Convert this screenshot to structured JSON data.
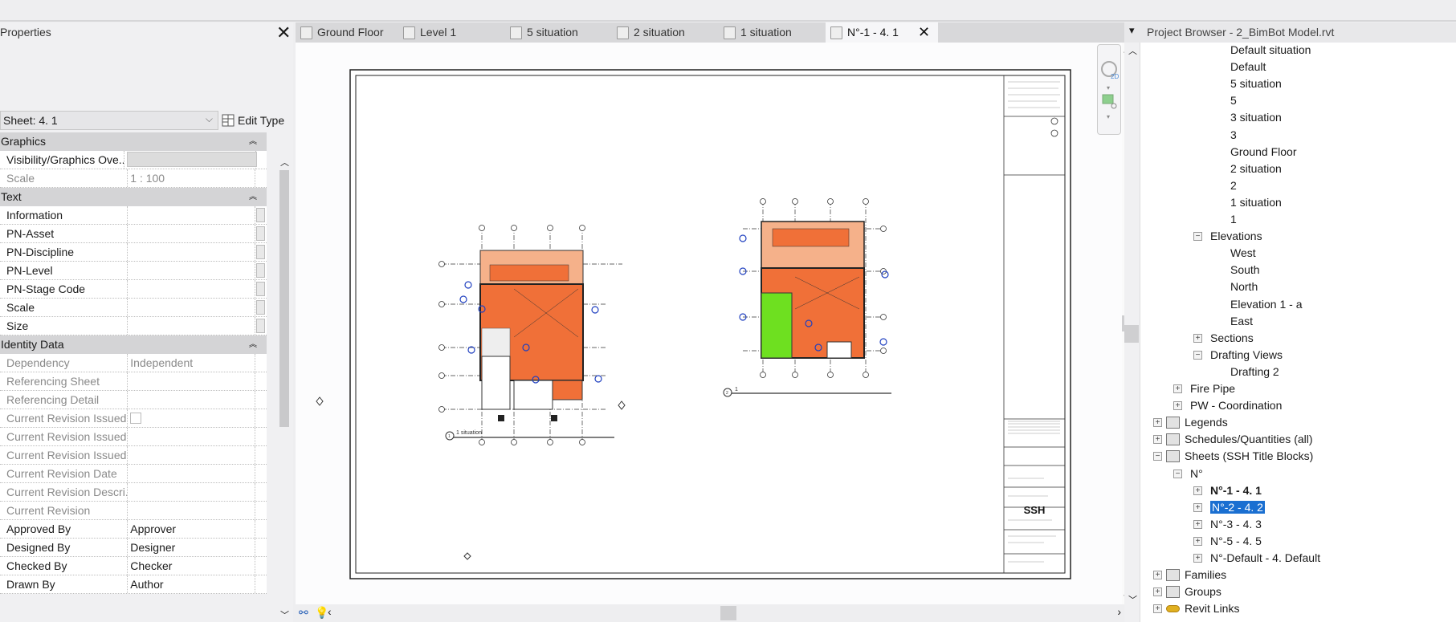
{
  "properties": {
    "title": "Properties",
    "type_selector": "Sheet: 4. 1",
    "edit_type_label": "Edit Type",
    "sections": [
      {
        "name": "Graphics",
        "rows": [
          {
            "key": "Visibility/Graphics Ove...",
            "value": "",
            "readonly": false,
            "kind": "button"
          },
          {
            "key": "Scale",
            "value": "1 : 100",
            "readonly": true
          }
        ]
      },
      {
        "name": "Text",
        "rows": [
          {
            "key": "Information",
            "value": ""
          },
          {
            "key": "PN-Asset",
            "value": ""
          },
          {
            "key": "PN-Discipline",
            "value": ""
          },
          {
            "key": "PN-Level",
            "value": ""
          },
          {
            "key": "PN-Stage Code",
            "value": ""
          },
          {
            "key": "Scale",
            "value": ""
          },
          {
            "key": "Size",
            "value": ""
          }
        ]
      },
      {
        "name": "Identity Data",
        "rows": [
          {
            "key": "Dependency",
            "value": "Independent",
            "readonly": true
          },
          {
            "key": "Referencing Sheet",
            "value": "",
            "readonly": true
          },
          {
            "key": "Referencing Detail",
            "value": "",
            "readonly": true
          },
          {
            "key": "Current Revision Issued",
            "value": "",
            "readonly": true,
            "kind": "checkbox",
            "checked": false
          },
          {
            "key": "Current Revision Issued...",
            "value": "",
            "readonly": true
          },
          {
            "key": "Current Revision Issued...",
            "value": "",
            "readonly": true
          },
          {
            "key": "Current Revision Date",
            "value": "",
            "readonly": true
          },
          {
            "key": "Current Revision Descri...",
            "value": "",
            "readonly": true
          },
          {
            "key": "Current Revision",
            "value": "",
            "readonly": true
          },
          {
            "key": "Approved By",
            "value": "Approver"
          },
          {
            "key": "Designed By",
            "value": "Designer"
          },
          {
            "key": "Checked By",
            "value": "Checker"
          },
          {
            "key": "Drawn By",
            "value": "Author"
          }
        ]
      }
    ]
  },
  "tabs": [
    {
      "label": "Ground Floor",
      "active": false
    },
    {
      "label": "Level 1",
      "active": false
    },
    {
      "label": "5 situation",
      "active": false
    },
    {
      "label": "2 situation",
      "active": false
    },
    {
      "label": "1 situation",
      "active": false
    },
    {
      "label": "N°-1 - 4. 1",
      "active": true
    }
  ],
  "sheet": {
    "view1_title": "1 situation",
    "view1_number": "1",
    "view2_title": "1",
    "view2_number": "2",
    "title_block_logo": "SSH",
    "plan_color": "#f07038",
    "wet_area_color": "#6ee020",
    "tag_color": "#2040c0"
  },
  "browser": {
    "title": "Project Browser - 2_BimBot Model.rvt",
    "items": [
      {
        "label": "Default situation",
        "depth": 3
      },
      {
        "label": "Default",
        "depth": 3
      },
      {
        "label": "5 situation",
        "depth": 3
      },
      {
        "label": "5",
        "depth": 3
      },
      {
        "label": "3 situation",
        "depth": 3
      },
      {
        "label": "3",
        "depth": 3
      },
      {
        "label": "Ground Floor",
        "depth": 3
      },
      {
        "label": "2 situation",
        "depth": 3
      },
      {
        "label": "2",
        "depth": 3
      },
      {
        "label": "1 situation",
        "depth": 3
      },
      {
        "label": "1",
        "depth": 3
      },
      {
        "label": "Elevations",
        "depth": 2,
        "state": "expanded"
      },
      {
        "label": "West",
        "depth": 3
      },
      {
        "label": "South",
        "depth": 3
      },
      {
        "label": "North",
        "depth": 3
      },
      {
        "label": "Elevation 1 - a",
        "depth": 3
      },
      {
        "label": "East",
        "depth": 3
      },
      {
        "label": "Sections",
        "depth": 2,
        "state": "collapsed"
      },
      {
        "label": "Drafting Views",
        "depth": 2,
        "state": "expanded"
      },
      {
        "label": "Drafting 2",
        "depth": 3
      },
      {
        "label": "Fire Pipe",
        "depth": 1,
        "state": "collapsed"
      },
      {
        "label": "PW - Coordination",
        "depth": 1,
        "state": "collapsed"
      },
      {
        "label": "Legends",
        "depth": 0,
        "state": "collapsed",
        "icon": "legend-icon"
      },
      {
        "label": "Schedules/Quantities (all)",
        "depth": 0,
        "state": "collapsed",
        "icon": "schedule-icon"
      },
      {
        "label": "Sheets (SSH Title Blocks)",
        "depth": 0,
        "state": "expanded",
        "icon": "sheet-icon"
      },
      {
        "label": "N°",
        "depth": 1,
        "state": "expanded"
      },
      {
        "label": "N°-1 - 4. 1",
        "depth": 2,
        "state": "collapsed",
        "bold": true
      },
      {
        "label": "N°-2 - 4. 2",
        "depth": 2,
        "state": "collapsed",
        "selected": true
      },
      {
        "label": "N°-3 - 4. 3",
        "depth": 2,
        "state": "collapsed"
      },
      {
        "label": "N°-5 - 4. 5",
        "depth": 2,
        "state": "collapsed"
      },
      {
        "label": "N°-Default - 4. Default",
        "depth": 2,
        "state": "collapsed"
      },
      {
        "label": "Families",
        "depth": 0,
        "state": "collapsed",
        "icon": "families-icon"
      },
      {
        "label": "Groups",
        "depth": 0,
        "state": "collapsed",
        "icon": "groups-icon"
      },
      {
        "label": "Revit Links",
        "depth": 0,
        "state": "collapsed",
        "icon": "revit-links-icon"
      }
    ]
  },
  "colors": {
    "selection": "#1a6fd1"
  }
}
